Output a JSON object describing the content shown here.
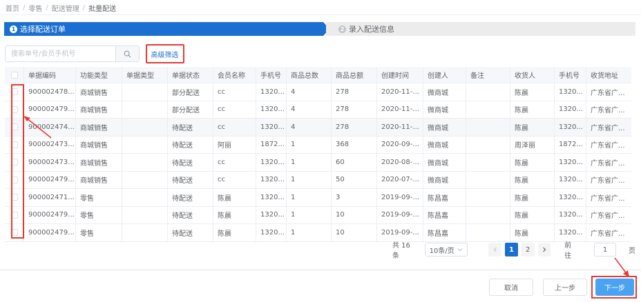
{
  "breadcrumb": [
    "首页",
    "零售",
    "配送管理",
    "批量配送"
  ],
  "steps": [
    {
      "num": "1",
      "label": "选择配送订单"
    },
    {
      "num": "2",
      "label": "录入配送信息"
    }
  ],
  "search": {
    "placeholder": "搜索单号/会员手机号",
    "value": ""
  },
  "advanced_filter_label": "高级筛选",
  "table": {
    "headers": [
      "单据编码",
      "功能类型",
      "单据类型",
      "单据状态",
      "会员名称",
      "手机号",
      "商品总数",
      "商品总额",
      "创建时间",
      "创建人",
      "备注",
      "收货人",
      "手机号",
      "收货地址"
    ],
    "rows": [
      [
        "900002478...",
        "商城销售",
        "",
        "部分配送",
        "cc",
        "1320...",
        "4",
        "278",
        "2020-11-...",
        "微商城",
        "",
        "陈晨",
        "1320...",
        "广东省广..."
      ],
      [
        "900002479...",
        "商城销售",
        "",
        "部分配送",
        "cc",
        "1320...",
        "4",
        "278",
        "2020-11-...",
        "微商城",
        "",
        "陈晨",
        "1320...",
        "广东省广..."
      ],
      [
        "900002474...",
        "商城销售",
        "",
        "待配送",
        "cc",
        "1320...",
        "4",
        "278",
        "2020-11-...",
        "微商城",
        "",
        "陈晨",
        "1320...",
        "广东省广..."
      ],
      [
        "900002473...",
        "商城销售",
        "",
        "待配送",
        "阿丽",
        "1872...",
        "1",
        "368",
        "2020-09-...",
        "微商城",
        "",
        "周泽丽",
        "1872...",
        "广东省广..."
      ],
      [
        "900002473...",
        "商城销售",
        "",
        "待配送",
        "cc",
        "1320...",
        "1",
        "60",
        "2020-08-...",
        "微商城",
        "",
        "陈晨",
        "1320...",
        "广东省广..."
      ],
      [
        "900002479...",
        "商城销售",
        "",
        "待配送",
        "cc",
        "1320...",
        "1",
        "50",
        "2020-07-...",
        "微商城",
        "",
        "陈晨",
        "1320...",
        "广东省广..."
      ],
      [
        "900002471...",
        "零售",
        "",
        "待配送",
        "陈晨",
        "1320...",
        "1",
        "3",
        "2019-09-...",
        "陈昌嘉",
        "",
        "陈晨",
        "1320...",
        "广东省广..."
      ],
      [
        "900002479...",
        "零售",
        "",
        "待配送",
        "陈晨",
        "1320...",
        "1",
        "10",
        "2019-09-...",
        "陈昌嘉",
        "",
        "陈晨",
        "1320...",
        "广东省广..."
      ],
      [
        "900002479...",
        "零售",
        "",
        "待配送",
        "陈晨",
        "1320...",
        "1",
        "10",
        "2019-09-...",
        "陈昌嘉",
        "",
        "陈晨",
        "1320...",
        "广东省广..."
      ]
    ]
  },
  "pagination": {
    "total": "共 16 条",
    "page_size": "10条/页",
    "pages": [
      "1",
      "2"
    ],
    "current_page": "1",
    "goto_label": "前往",
    "goto_value": "1",
    "goto_suffix": "页"
  },
  "buttons": {
    "cancel": "取消",
    "prev": "上一步",
    "next": "下一步"
  },
  "colors": {
    "primary": "#1b6fd1",
    "next_button": "#4aa3f0",
    "annotation": "#e53935"
  }
}
